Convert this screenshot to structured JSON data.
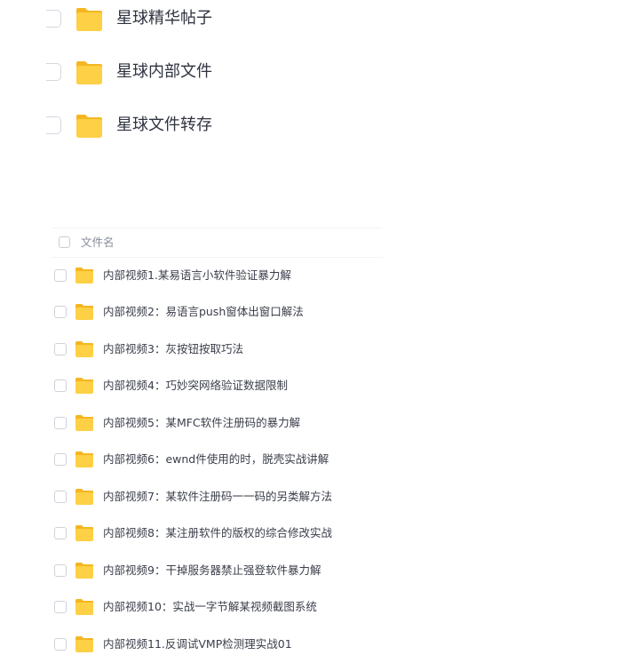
{
  "big_folders": [
    {
      "label": "星球精华帖子",
      "icon": "folder-icon"
    },
    {
      "label": "星球内部文件",
      "icon": "folder-icon"
    },
    {
      "label": "星球文件转存",
      "icon": "folder-icon"
    }
  ],
  "file_table": {
    "header_label": "文件名",
    "rows": [
      {
        "name": "内部视频1.某易语言小软件验证暴力解",
        "icon": "folder-icon"
      },
      {
        "name": "内部视频2：易语言push窗体出窗口解法",
        "icon": "folder-icon"
      },
      {
        "name": "内部视频3：灰按钮按取巧法",
        "icon": "folder-icon"
      },
      {
        "name": "内部视频4：巧妙突网络验证数据限制",
        "icon": "folder-icon"
      },
      {
        "name": "内部视频5：某MFC软件注册码的暴力解",
        "icon": "folder-icon"
      },
      {
        "name": "内部视频6：ewnd件使用的时，脱壳实战讲解",
        "icon": "folder-icon"
      },
      {
        "name": "内部视频7：某软件注册码一一码的另类解方法",
        "icon": "folder-icon"
      },
      {
        "name": "内部视频8：某注册软件的版权的综合修改实战",
        "icon": "folder-icon"
      },
      {
        "name": "内部视频9：干掉服务器禁止强登软件暴力解",
        "icon": "folder-icon"
      },
      {
        "name": "内部视频10：实战一字节解某视频截图系统",
        "icon": "folder-icon"
      },
      {
        "name": "内部视频11.反调试VMP检测理实战01",
        "icon": "folder-icon"
      }
    ]
  },
  "colors": {
    "folder_body": "#fdd045",
    "folder_back": "#f5b621",
    "text_primary": "#2f3340",
    "text_muted": "#878c9c",
    "checkbox_border": "#cfd2d9"
  }
}
